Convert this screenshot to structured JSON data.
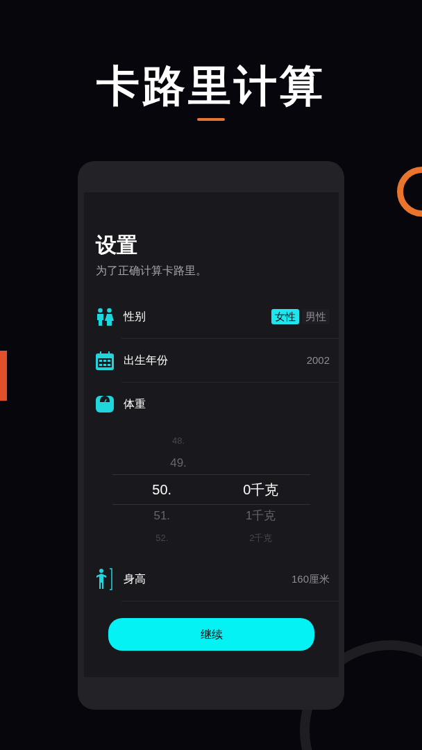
{
  "title": "卡路里计算",
  "screen": {
    "heading": "设置",
    "subtitle": "为了正确计算卡路里。",
    "rows": [
      {
        "kind": "gender",
        "label": "性别",
        "options": [
          {
            "label": "女性",
            "selected": true
          },
          {
            "label": "男性",
            "selected": false
          }
        ]
      },
      {
        "kind": "birth_year",
        "label": "出生年份",
        "value": "2002"
      },
      {
        "kind": "weight",
        "label": "体重",
        "picker": [
          {
            "integer": "48.",
            "selected": false
          },
          {
            "integer": "49.",
            "selected": false
          },
          {
            "integer": "50.",
            "decimal": "0千克",
            "selected": true
          },
          {
            "integer": "51.",
            "decimal": "1千克",
            "selected": false
          },
          {
            "integer": "52.",
            "decimal": "2千克",
            "selected": false
          }
        ]
      },
      {
        "kind": "height",
        "label": "身高",
        "value": "160厘米"
      }
    ],
    "button": "继续"
  }
}
